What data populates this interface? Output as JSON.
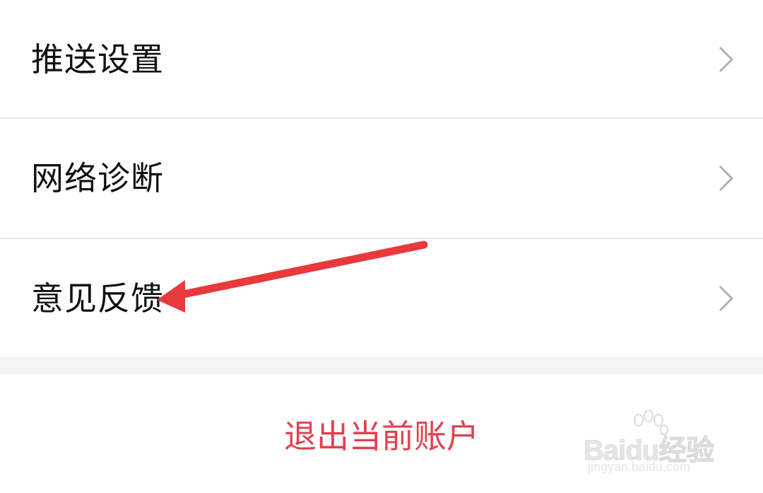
{
  "menu": {
    "items": [
      {
        "label": "推送设置",
        "icon": "chevron-right-icon"
      },
      {
        "label": "网络诊断",
        "icon": "chevron-right-icon"
      },
      {
        "label": "意见反馈",
        "icon": "chevron-right-icon"
      }
    ]
  },
  "logout": {
    "label": "退出当前账户"
  },
  "annotation": {
    "icon": "red-arrow-icon",
    "color": "#e8393d"
  },
  "watermark": {
    "brand": "Baidu经验",
    "site": "jingyan.baidu.com"
  },
  "colors": {
    "text": "#111111",
    "logout": "#e2414f",
    "divider": "#e6e6e6",
    "section_gap": "#f5f5f5",
    "chevron": "#b0b0b0"
  }
}
